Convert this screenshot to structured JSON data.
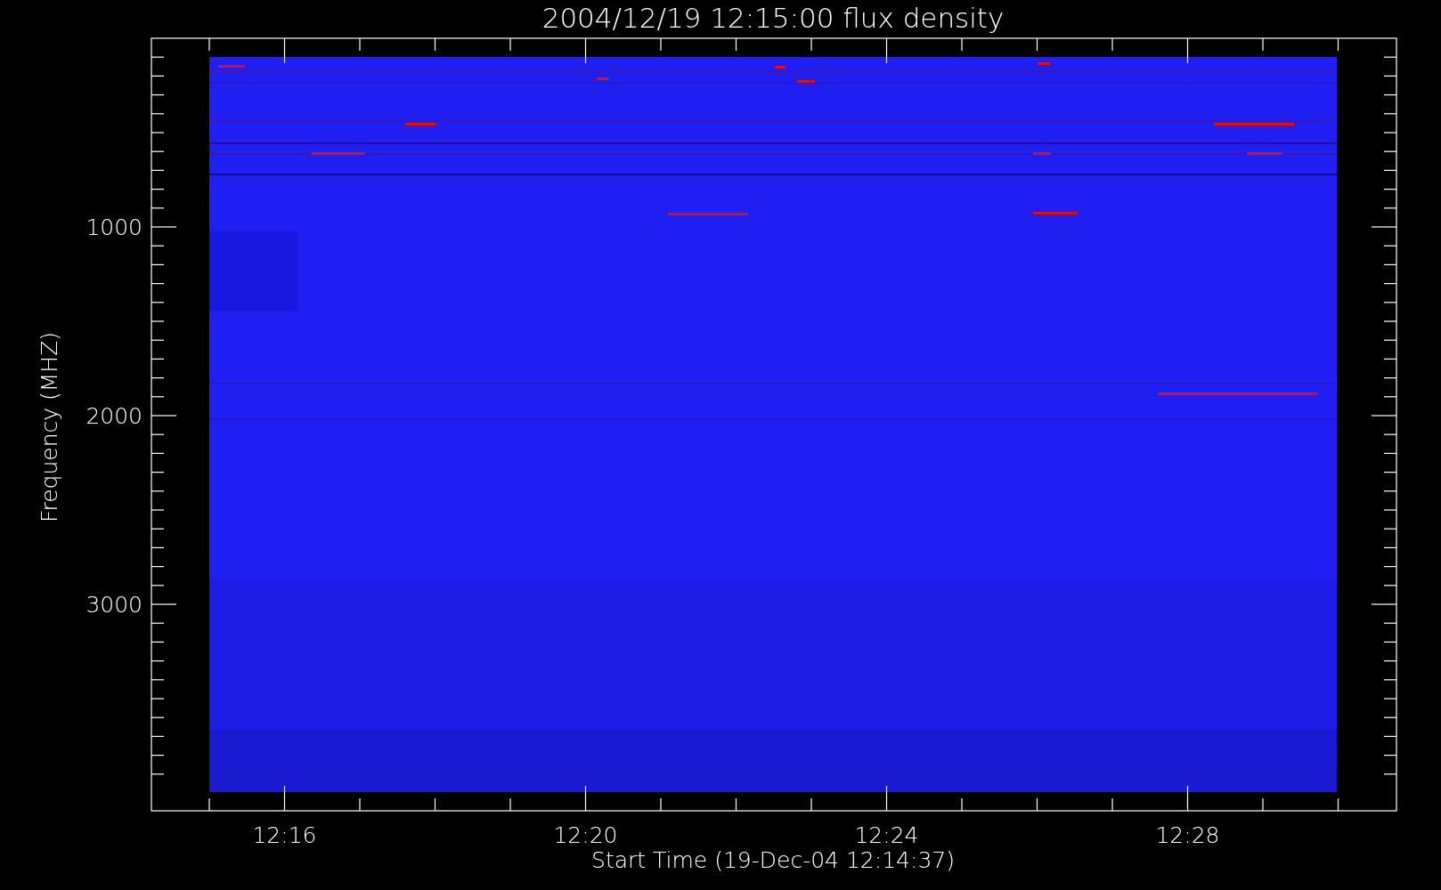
{
  "plot": {
    "title": "2004/12/19 12:15:00 flux density",
    "xlabel": "Start Time (19-Dec-04 12:14:37)",
    "ylabel": "Frequency (MHZ)",
    "x_tick_labels": [
      "12:16",
      "12:20",
      "12:24",
      "12:28"
    ],
    "y_tick_labels": [
      "1000",
      "2000",
      "3000"
    ]
  }
}
